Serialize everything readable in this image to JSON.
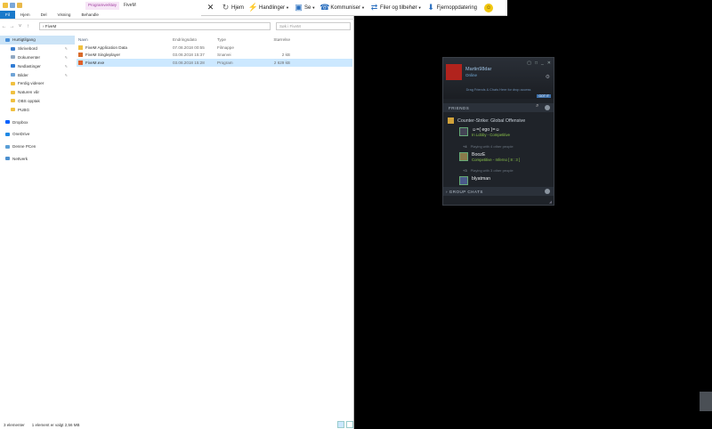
{
  "explorer": {
    "context_tab": "Programverktøy",
    "title": "FiveM",
    "ribbon_tabs": [
      "Fil",
      "Hjem",
      "Del",
      "Visning",
      "Behandle"
    ],
    "address": "› FiveM",
    "search_placeholder": "Søk i FiveM",
    "nav": {
      "quick_access": "Hurtigtilgang",
      "pinned": [
        "Skrivebord",
        "Dokumenter",
        "Nedlastinger",
        "Bilder"
      ],
      "folders": [
        "Ferdig videoer",
        "Naturen vår",
        "OBS opptak",
        "PUBG"
      ],
      "dropbox": "Dropbox",
      "onedrive": "OneDrive",
      "thispc": "Denne PCen",
      "network": "Nettverk"
    },
    "columns": {
      "name": "Navn",
      "date": "Endringsdato",
      "type": "Type",
      "size": "Størrelse"
    },
    "files": [
      {
        "name": "FiveM Application Data",
        "date": "07.08.2018 00:55",
        "type": "Filmappe",
        "size": ""
      },
      {
        "name": "FiveM Singleplayer",
        "date": "03.08.2018 15:37",
        "type": "Snarvei",
        "size": "2 kB"
      },
      {
        "name": "FiveM.exe",
        "date": "03.08.2018 15:28",
        "type": "Program",
        "size": "2 629 kB"
      }
    ],
    "status": {
      "count": "3 elementer",
      "selected": "1 element er valgt 2,56 MB"
    }
  },
  "toolbar": {
    "home": "Hjem",
    "actions": "Handlinger",
    "view": "Se",
    "communicate": "Kommuniser",
    "files": "Filer og tilbehør",
    "update": "Fjernoppdatering"
  },
  "steam": {
    "username": "Martin98dar",
    "status": "Online",
    "drag_hint": "Drag Friends & Chats Here for drop access",
    "got_it": "GOT IT",
    "friends_header": "FRIENDS",
    "game": "Counter-Strike: Global Offensive",
    "friends": [
      {
        "name": "☺=( ego )=☺",
        "status": "In Lobby - Competitive",
        "party_count": "+4",
        "party_text": "Playing with 4 other people"
      },
      {
        "name": "BoozE",
        "status": "Competitive - Inferno [ 8 : 3 ]",
        "party_count": "+3",
        "party_text": "Playing with 3 other people"
      },
      {
        "name": "blyatman",
        "status": "",
        "party_count": "",
        "party_text": ""
      }
    ],
    "group_chats": "GROUP CHATS"
  },
  "colors": {
    "ribbon_file": "#1979ca",
    "selection": "#cce8ff",
    "steam_bg": "#1f2329",
    "steam_in_game": "#8bc34a"
  }
}
